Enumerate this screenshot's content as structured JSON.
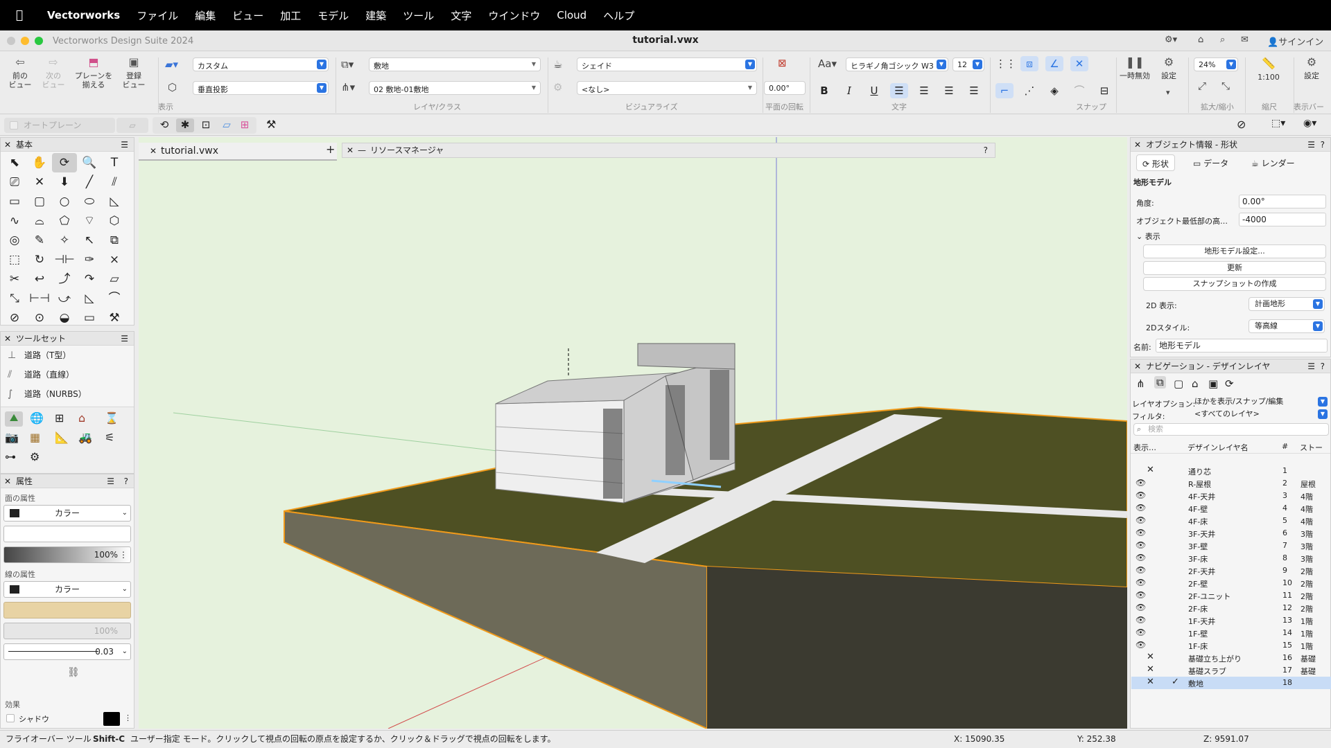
{
  "menubar": {
    "items": [
      "Vectorworks",
      "ファイル",
      "編集",
      "ビュー",
      "加工",
      "モデル",
      "建築",
      "ツール",
      "文字",
      "ウインドウ",
      "Cloud",
      "ヘルプ"
    ]
  },
  "window": {
    "app_title": "Vectorworks Design Suite 2024",
    "doc_title": "tutorial.vwx",
    "signin": "サインイン"
  },
  "toolbar": {
    "prev_view": "前の\nビュー",
    "next_view": "次の\nビュー",
    "align_plane": "プレーンを\n揃える",
    "saved_view": "登録\nビュー",
    "group_display": "表示",
    "group_layer": "レイヤ/クラス",
    "group_visualize": "ビジュアライズ",
    "group_rotate": "平面の回転",
    "group_text": "文字",
    "group_snap": "スナップ",
    "group_zoom": "拡大/縮小",
    "group_scale": "縮尺",
    "group_displaybar": "表示バー",
    "plane_value": "カスタム",
    "projection_value": "垂直投影",
    "layer_value": "敷地",
    "class_value": "02 敷地-01敷地",
    "render_value": "シェイド",
    "light_value": "<なし>",
    "rotation_value": "0.00°",
    "font_value": "ヒラギノ角ゴシック W3",
    "font_size": "12",
    "pause_label": "一時無効",
    "settings_label": "設定",
    "zoom_value": "24%",
    "scale_value": "1:100",
    "displaybar_settings": "設定",
    "auto_plane": "オートプレーン"
  },
  "basic_palette": {
    "title": "基本",
    "tools": [
      "⬉",
      "✋",
      "⟳",
      "🔍",
      "T",
      "⎚",
      "✕",
      "⬇",
      "╱",
      "⫽",
      "▭",
      "▢",
      "○",
      "⬭",
      "◺",
      "∿",
      "⌓",
      "⬠",
      "⌔",
      "⬡",
      "◎",
      "✎",
      "✧",
      "↖",
      "⧉",
      "⬚",
      "↻",
      "⊣⊢",
      "✑",
      "⨯",
      "✂",
      "↩",
      "⤴",
      "↷",
      "▱",
      "⤡",
      "⊢⊣",
      "⤻",
      "◺",
      "⌒",
      "⊘",
      "⊙",
      "◒",
      "▭",
      "⚒"
    ]
  },
  "toolsets": {
    "title": "ツールセット",
    "items": [
      "道路（T型）",
      "道路（直線）",
      "道路（NURBS）"
    ]
  },
  "attributes": {
    "title": "属性",
    "fill_label": "面の属性",
    "fill_type": "カラー",
    "opacity": "100%",
    "pen_label": "線の属性",
    "pen_type": "カラー",
    "pen_opacity": "100%",
    "line_weight": "0.03",
    "effects_label": "効果",
    "shadow_label": "シャドウ",
    "pen_color": "#e8d3a4"
  },
  "canvas": {
    "doc_tab": "tutorial.vwx",
    "resource_manager": "リソースマネージャ"
  },
  "oip": {
    "title": "オブジェクト情報 - 形状",
    "tab_shape": "形状",
    "tab_data": "データ",
    "tab_render": "レンダー",
    "object_type": "地形モデル",
    "angle_label": "角度:",
    "angle_value": "0.00°",
    "bottom_label": "オブジェクト最低部の高…",
    "bottom_value": "-4000",
    "display_section": "表示",
    "btn_settings": "地形モデル設定...",
    "btn_update": "更新",
    "btn_snapshot": "スナップショットの作成",
    "display2d_label": "2D 表示:",
    "display2d_value": "計画地形",
    "style2d_label": "2Dスタイル:",
    "style2d_value": "等高線",
    "name_label": "名前:",
    "name_value": "地形モデル"
  },
  "navigation": {
    "title": "ナビゲーション - デザインレイヤ",
    "layer_options_label": "レイヤオプション:",
    "layer_options_value": "ほかを表示/スナップ/編集",
    "filter_label": "フィルタ:",
    "filter_value": "<すべてのレイヤ>",
    "search_placeholder": "検索",
    "col_visibility": "表示…",
    "col_name": "デザインレイヤ名",
    "col_number": "#",
    "col_story": "ストー",
    "layers": [
      {
        "vis": "",
        "mark": "✕",
        "name": "通り芯",
        "no": "1",
        "story": ""
      },
      {
        "vis": "👁",
        "mark": "",
        "name": "R-屋根",
        "no": "2",
        "story": "屋根"
      },
      {
        "vis": "👁",
        "mark": "",
        "name": "4F-天井",
        "no": "3",
        "story": "4階"
      },
      {
        "vis": "👁",
        "mark": "",
        "name": "4F-壁",
        "no": "4",
        "story": "4階"
      },
      {
        "vis": "👁",
        "mark": "",
        "name": "4F-床",
        "no": "5",
        "story": "4階"
      },
      {
        "vis": "👁",
        "mark": "",
        "name": "3F-天井",
        "no": "6",
        "story": "3階"
      },
      {
        "vis": "👁",
        "mark": "",
        "name": "3F-壁",
        "no": "7",
        "story": "3階"
      },
      {
        "vis": "👁",
        "mark": "",
        "name": "3F-床",
        "no": "8",
        "story": "3階"
      },
      {
        "vis": "👁",
        "mark": "",
        "name": "2F-天井",
        "no": "9",
        "story": "2階"
      },
      {
        "vis": "👁",
        "mark": "",
        "name": "2F-壁",
        "no": "10",
        "story": "2階"
      },
      {
        "vis": "👁",
        "mark": "",
        "name": "2F-ユニット",
        "no": "11",
        "story": "2階"
      },
      {
        "vis": "👁",
        "mark": "",
        "name": "2F-床",
        "no": "12",
        "story": "2階"
      },
      {
        "vis": "👁",
        "mark": "",
        "name": "1F-天井",
        "no": "13",
        "story": "1階"
      },
      {
        "vis": "👁",
        "mark": "",
        "name": "1F-壁",
        "no": "14",
        "story": "1階"
      },
      {
        "vis": "👁",
        "mark": "",
        "name": "1F-床",
        "no": "15",
        "story": "1階"
      },
      {
        "vis": "",
        "mark": "✕",
        "name": "基礎立ち上がり",
        "no": "16",
        "story": "基礎"
      },
      {
        "vis": "",
        "mark": "✕",
        "name": "基礎スラブ",
        "no": "17",
        "story": "基礎"
      },
      {
        "vis": "",
        "mark": "✕",
        "name": "敷地",
        "no": "18",
        "story": "",
        "active": true
      }
    ]
  },
  "statusbar": {
    "tool_name": "フライオーバー ツール",
    "shortcut": "Shift-C",
    "hint": "ユーザー指定 モード。クリックして視点の回転の原点を設定するか、クリック＆ドラッグで視点の回転をします。",
    "x": "X: 15090.35",
    "y": "Y: 252.38",
    "z": "Z: 9591.07"
  }
}
